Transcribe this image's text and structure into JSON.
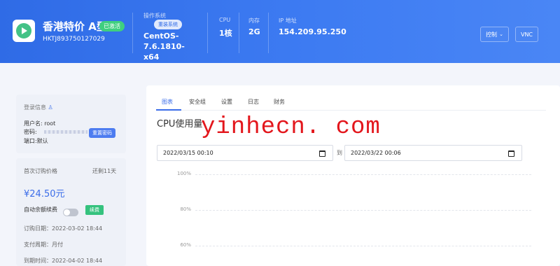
{
  "header": {
    "product_name": "香港特价 A型",
    "status_badge": "已激活",
    "product_id": "HKTJ893750127029",
    "os_label": "操作系统",
    "reinstall_label": "重装系统",
    "os_value": "CentOS-7.6.1810-x64",
    "cpu_label": "CPU",
    "cpu_value": "1核",
    "memory_label": "内存",
    "memory_value": "2G",
    "ip_label": "IP 地址",
    "ip_value": "154.209.95.250",
    "control_button": "控制",
    "vnc_button": "VNC"
  },
  "login": {
    "title": "登录信息",
    "username_label": "用户名:",
    "username_value": "root",
    "password_label": "密码:",
    "reset_password": "重置密码",
    "port_label": "端口:",
    "port_value": "默认"
  },
  "billing": {
    "first_price_label": "首次订购价格",
    "remaining": "还剩11天",
    "price": "¥24.50元",
    "auto_renew_label": "自动余额续费",
    "auto_renew_on": false,
    "renew_button": "续费",
    "order_date": "订购日期：2022-03-02 18:44",
    "pay_cycle": "支付周期：月付",
    "expire_date": "到期时间：2022-04-02 18:44"
  },
  "tabs": [
    "图表",
    "安全组",
    "设置",
    "日志",
    "财务"
  ],
  "active_tab": 0,
  "chart": {
    "title": "CPU使用量",
    "start_date": "2022/03/15 00:10",
    "to_label": "到",
    "end_date": "2022/03/22 00:06",
    "yticks": [
      "100%",
      "80%",
      "60%"
    ]
  },
  "watermark": "yinhecn. com",
  "colors": {
    "header_bg": "#3d7bf2",
    "accent": "#3b6de9",
    "success": "#3fcf7f"
  }
}
